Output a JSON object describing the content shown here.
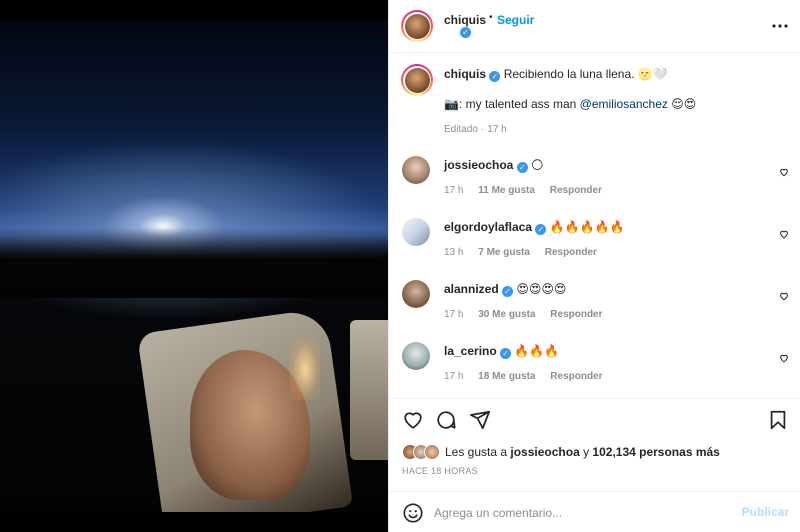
{
  "header": {
    "username": "chiquis",
    "separator": "•",
    "follow_label": "Seguir",
    "more_icon": "more-horizontal-icon"
  },
  "caption": {
    "username": "chiquis",
    "text": "Recibiendo la luna llena. 🌝🤍",
    "line2_prefix": "📷: my talented ass man ",
    "line2_mention": "@emiliosanchez",
    "line2_suffix": " 😌😍",
    "edited": "Editado",
    "dot": "·",
    "time": "17 h"
  },
  "comments": [
    {
      "username": "jossieochoa",
      "text": "🌕",
      "time": "17 h",
      "likes": "11 Me gusta",
      "reply": "Responder"
    },
    {
      "username": "elgordoylaflaca",
      "text": "🔥🔥🔥🔥🔥",
      "time": "13 h",
      "likes": "7 Me gusta",
      "reply": "Responder"
    },
    {
      "username": "alannized",
      "text": "😍😍😍😍",
      "time": "17 h",
      "likes": "30 Me gusta",
      "reply": "Responder"
    },
    {
      "username": "la_cerino",
      "text": "🔥🔥🔥",
      "time": "17 h",
      "likes": "18 Me gusta",
      "reply": "Responder"
    }
  ],
  "likes": {
    "prefix": "Les gusta a ",
    "first_user": "jossieochoa",
    "middle": " y ",
    "count": "102,134 personas más"
  },
  "timestamp": "HACE 18 HORAS",
  "comment_box": {
    "placeholder": "Agrega un comentario...",
    "post_label": "Publicar"
  },
  "colors": {
    "link_blue": "#0095f6",
    "verified_blue": "#3897f0",
    "muted": "#8e8e8e",
    "border": "#efefef"
  }
}
